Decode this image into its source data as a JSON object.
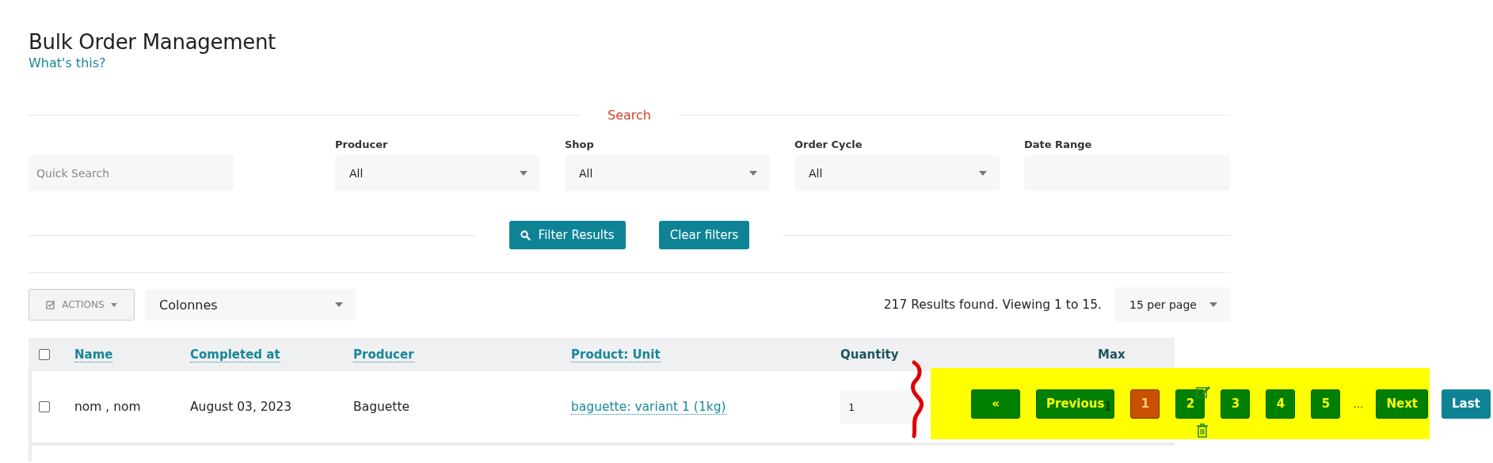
{
  "page": {
    "title": "Bulk Order Management",
    "help_link": "What's this?"
  },
  "search": {
    "heading": "Search",
    "quick_search": {
      "placeholder": "Quick Search"
    },
    "filters": [
      {
        "label": "Producer",
        "value": "All",
        "kind": "select"
      },
      {
        "label": "Shop",
        "value": "All",
        "kind": "select"
      },
      {
        "label": "Order Cycle",
        "value": "All",
        "kind": "select"
      },
      {
        "label": "Date Range",
        "kind": "input"
      }
    ],
    "buttons": [
      {
        "label": "Filter Results",
        "kind": "search"
      },
      {
        "label": "Clear filters",
        "kind": "plain"
      }
    ]
  },
  "toolbar": {
    "actions": "ACTIONS",
    "columns_select": "Colonnes",
    "results_text": "217 Results found. Viewing 1 to 15.",
    "per_page": "15 per page"
  },
  "table": {
    "select_all": {
      "checked": false
    },
    "columns": [
      {
        "label": "Name",
        "kind": "sort"
      },
      {
        "label": "Completed at",
        "kind": "sort"
      },
      {
        "label": "Producer",
        "kind": "sort"
      },
      {
        "label": "Product: Unit",
        "kind": "sort"
      },
      {
        "label": "Quantity",
        "kind": "plain"
      },
      {
        "label": "Max",
        "kind": "plain"
      }
    ],
    "rows": [
      {
        "checked": false,
        "name": "nom , nom",
        "completed_at": "August 03, 2023",
        "producer": "Baguette",
        "product_unit": "baguette: variant 1 (1kg)",
        "quantity": "1",
        "max": "1"
      }
    ]
  },
  "pagination": [
    {
      "label": "«",
      "kind": "page",
      "selected": false
    },
    {
      "label": "Previous",
      "kind": "page",
      "selected": false
    },
    {
      "label": "1",
      "kind": "page",
      "selected": true
    },
    {
      "label": "2",
      "kind": "page",
      "selected": false
    },
    {
      "label": "3",
      "kind": "page",
      "selected": false
    },
    {
      "label": "4",
      "kind": "page",
      "selected": false
    },
    {
      "label": "5",
      "kind": "page",
      "selected": false
    },
    {
      "label": "…",
      "kind": "gap"
    },
    {
      "label": "Next",
      "kind": "page",
      "selected": false
    },
    {
      "label": "Last",
      "kind": "last",
      "selected": false
    }
  ]
}
